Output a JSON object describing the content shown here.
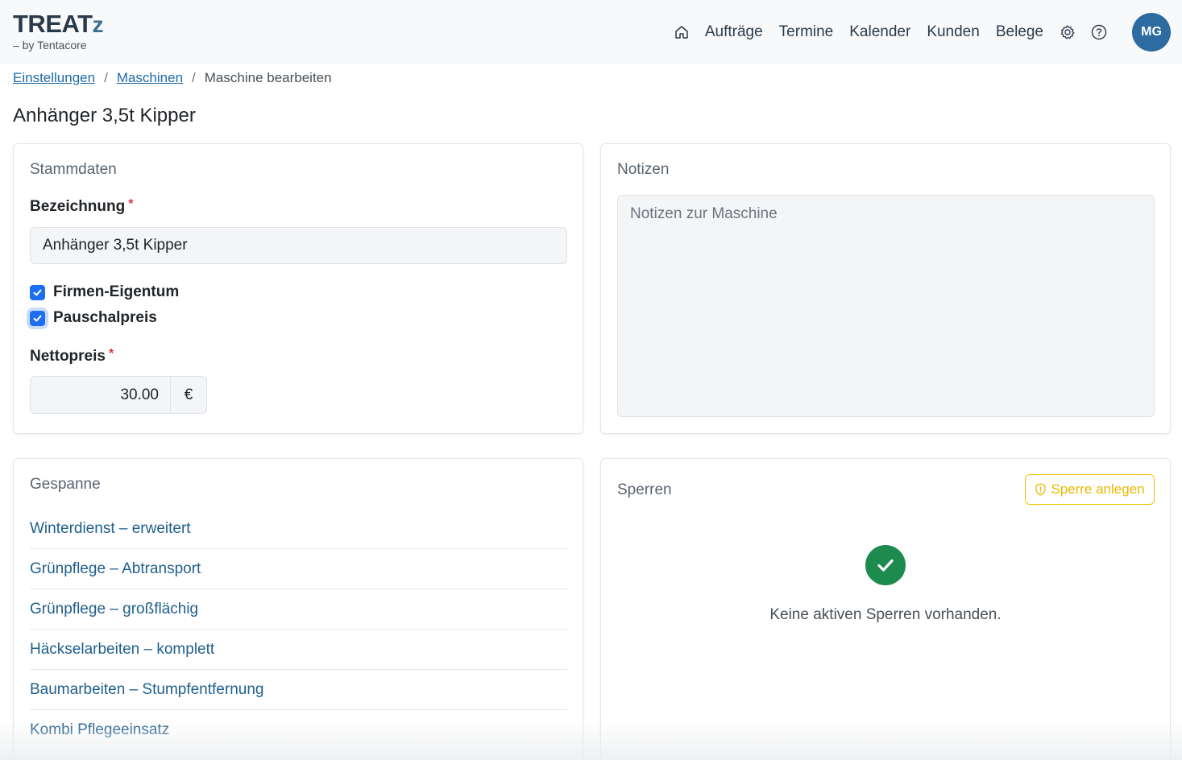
{
  "header": {
    "logo_main": "TREAT",
    "logo_z": "z",
    "logo_sub": "– by Tentacore",
    "nav": [
      "Aufträge",
      "Termine",
      "Kalender",
      "Kunden",
      "Belege"
    ],
    "avatar_initials": "MG"
  },
  "breadcrumb": {
    "items": [
      "Einstellungen",
      "Maschinen"
    ],
    "current": "Maschine bearbeiten"
  },
  "page_title": "Anhänger 3,5t Kipper",
  "stammdaten": {
    "title": "Stammdaten",
    "bezeichnung_label": "Bezeichnung",
    "required_mark": "*",
    "bezeichnung_value": "Anhänger 3,5t Kipper",
    "checkboxes": [
      {
        "label": "Firmen-Eigentum",
        "checked": true
      },
      {
        "label": "Pauschalpreis",
        "checked": true
      }
    ],
    "nettopreis_label": "Nettopreis",
    "nettopreis_value": "30.00",
    "currency": "€"
  },
  "notizen": {
    "title": "Notizen",
    "placeholder": "Notizen zur Maschine"
  },
  "gespanne": {
    "title": "Gespanne",
    "items": [
      "Winterdienst – erweitert",
      "Grünpflege – Abtransport",
      "Grünpflege – großflächig",
      "Häckselarbeiten – komplett",
      "Baumarbeiten – Stumpfentfernung",
      "Kombi Pflegeeinsatz"
    ]
  },
  "sperren": {
    "title": "Sperren",
    "button_label": "Sperre anlegen",
    "empty_text": "Keine aktiven Sperren vorhanden."
  },
  "colors": {
    "primary": "#2d6ba0",
    "link": "#1f5f8c",
    "checkbox": "#1c6ef2",
    "warning": "#f2c200",
    "success": "#1d8a4e",
    "required": "#dc3545"
  }
}
